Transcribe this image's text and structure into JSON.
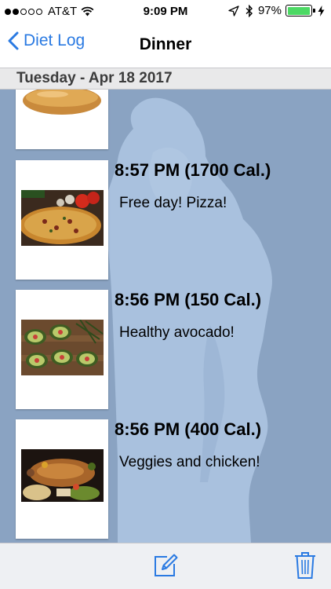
{
  "status_bar": {
    "carrier": "AT&T",
    "time": "9:09 PM",
    "battery_percent": "97%",
    "battery_level": 0.97,
    "signal_bars": 2,
    "icons": [
      "wifi-icon",
      "location-icon",
      "bluetooth-icon",
      "charging-icon"
    ]
  },
  "nav": {
    "back_label": "Diet Log",
    "title": "Dinner"
  },
  "date_header": "Tuesday - Apr 18 2017",
  "entries": [
    {
      "time_cal": "",
      "note": "",
      "photo": "bread-photo"
    },
    {
      "time_cal": "8:57 PM (1700 Cal.)",
      "note": "Free day! Pizza!",
      "photo": "pizza-photo"
    },
    {
      "time_cal": "8:56 PM (150 Cal.)",
      "note": "Healthy avocado!",
      "photo": "avocado-photo"
    },
    {
      "time_cal": "8:56 PM (400 Cal.)",
      "note": "Veggies and chicken!",
      "photo": "chicken-veggies-photo"
    }
  ],
  "toolbar": {
    "items": [
      "compose-icon",
      "trash-icon"
    ]
  },
  "colors": {
    "accent": "#2a7ae2",
    "background": "#8aa3c2",
    "silhouette": "#a9c1de",
    "battery": "#4cd964"
  }
}
